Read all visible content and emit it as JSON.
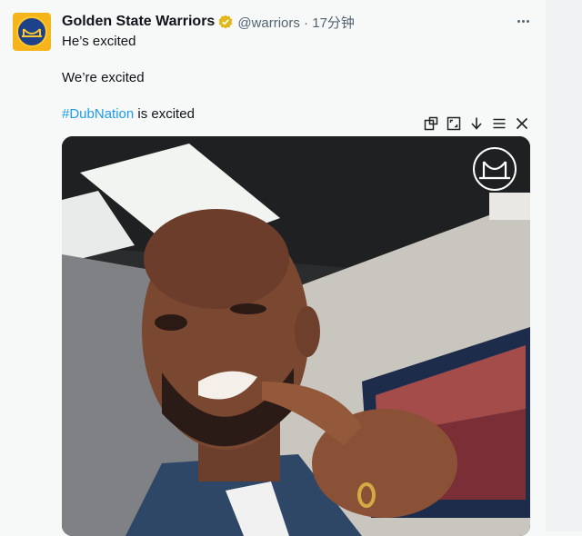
{
  "tweet": {
    "display_name": "Golden State Warriors",
    "handle_and_time": "@warriors · 17分钟",
    "lines": {
      "line1": "He’s excited",
      "line2": "We’re excited",
      "line3_hashtag": "#DubNation",
      "line3_rest": " is excited"
    },
    "avatar_icon": "warriors-logo-icon",
    "verified_icon": "gold-verified-badge-icon",
    "more_icon": "more-dots-icon"
  },
  "media_toolbar": {
    "icons": [
      "picture-in-picture-icon",
      "expand-icon",
      "download-icon",
      "menu-icon",
      "close-icon"
    ]
  },
  "media": {
    "type": "video-thumbnail",
    "watermark_icon": "warriors-bridge-logo-icon"
  },
  "colors": {
    "link": "#1d9bf0",
    "verified_gold": "#e2b719",
    "warriors_blue": "#1d428a",
    "warriors_gold": "#ffc72c"
  }
}
